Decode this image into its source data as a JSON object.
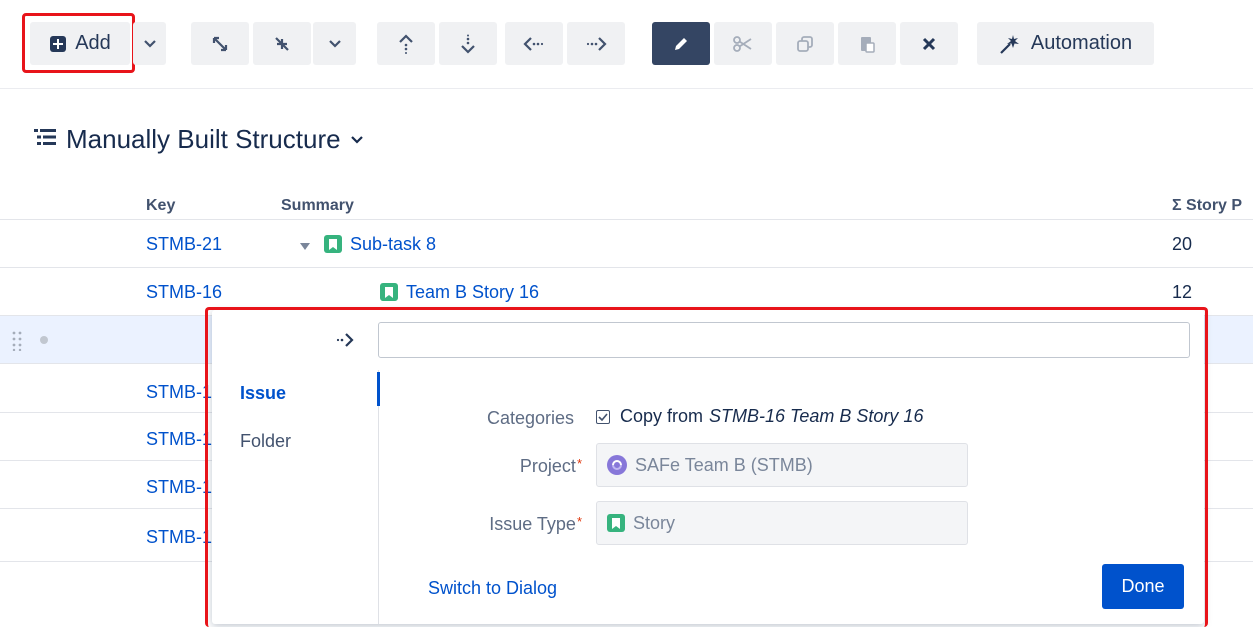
{
  "toolbar": {
    "add_label": "Add",
    "automation_label": "Automation",
    "icons": [
      "plus-box-icon",
      "chevron-down-icon",
      "expand-icon",
      "collapse-icon",
      "chevron-down-icon",
      "move-up-icon",
      "move-down-icon",
      "outdent-icon",
      "indent-icon",
      "edit-icon",
      "cut-icon",
      "copy-icon",
      "paste-icon",
      "delete-icon",
      "automation-wand-icon"
    ]
  },
  "structure": {
    "title": "Manually Built Structure"
  },
  "table": {
    "columns": {
      "key": "Key",
      "summary": "Summary",
      "story_points": "Σ Story P"
    },
    "rows": [
      {
        "key": "STMB-21",
        "summary": "Sub-task 8",
        "story_points": "20"
      },
      {
        "key": "STMB-16",
        "summary": "Team B Story 16",
        "story_points": "12"
      },
      {
        "key": "",
        "summary": "",
        "story_points": ""
      },
      {
        "key": "STMB-1",
        "summary": "",
        "story_points": ""
      },
      {
        "key": "STMB-1",
        "summary": "",
        "story_points": ""
      },
      {
        "key": "STMB-1",
        "summary": "",
        "story_points": ""
      },
      {
        "key": "STMB-1",
        "summary": "",
        "story_points": ""
      }
    ]
  },
  "popup": {
    "summary_value": "",
    "types": [
      {
        "label": "Issue",
        "active": true
      },
      {
        "label": "Folder",
        "active": false
      }
    ],
    "categories_label": "Categories",
    "copy_prefix": "Copy from",
    "copy_source": "STMB-16 Team B Story 16",
    "copy_checked": true,
    "project_label": "Project",
    "project_value": "SAFe Team B (STMB)",
    "issue_type_label": "Issue Type",
    "issue_type_value": "Story",
    "required_mark": "*",
    "switch_label": "Switch to Dialog",
    "done_label": "Done"
  },
  "colors": {
    "accent": "#0052cc",
    "highlight": "#e8141a",
    "story_green": "#36b37e",
    "active_tool": "#344563"
  }
}
